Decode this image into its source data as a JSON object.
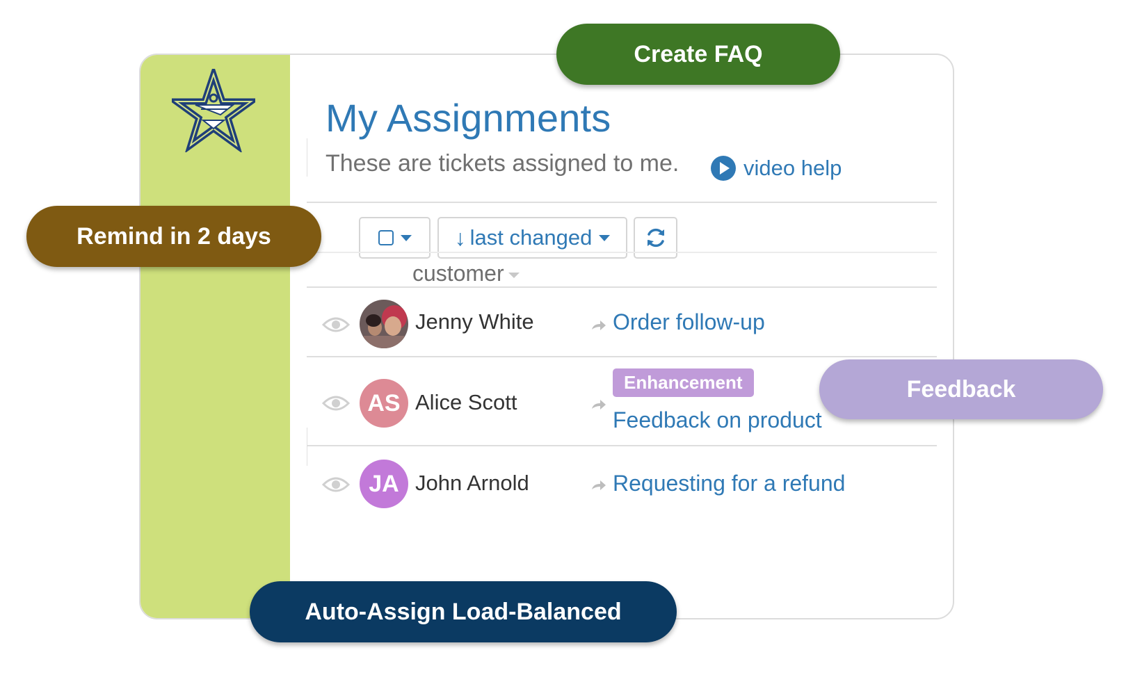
{
  "page": {
    "title": "My Assignments",
    "subtitle": "These are tickets assigned to me.",
    "video_help": "video help"
  },
  "toolbar": {
    "sort_arrow": "↓",
    "sort_label": "last changed"
  },
  "table": {
    "column_header": "customer",
    "rows": [
      {
        "name": "Jenny White",
        "subject": "Order follow-up",
        "avatar": "photo"
      },
      {
        "name": "Alice Scott",
        "initials": "AS",
        "avatar_color": "#dd8a95",
        "tag": "Enhancement",
        "subject": "Feedback on product"
      },
      {
        "name": "John Arnold",
        "initials": "JA",
        "avatar_color": "#c279d9",
        "subject": "Requesting for a refund"
      }
    ]
  },
  "feature_pills": {
    "create_faq": {
      "label": "Create FAQ",
      "color": "#3e7725"
    },
    "remind": {
      "label": "Remind in 2 days",
      "color": "#7f5a12"
    },
    "feedback": {
      "label": "Feedback",
      "color": "#b4a7d6"
    },
    "auto_assign": {
      "label": "Auto-Assign Load-Balanced",
      "color": "#0b3a62"
    }
  },
  "colors": {
    "sidebar": "#cee07c",
    "accent": "#2f79b5",
    "logo_navy": "#1f3f78",
    "tag": "#c09bd9"
  },
  "icons": [
    "star-logo-icon",
    "play-icon",
    "checkbox-icon",
    "caret-down-icon",
    "refresh-icon",
    "eye-icon",
    "reply-arrow-icon"
  ]
}
